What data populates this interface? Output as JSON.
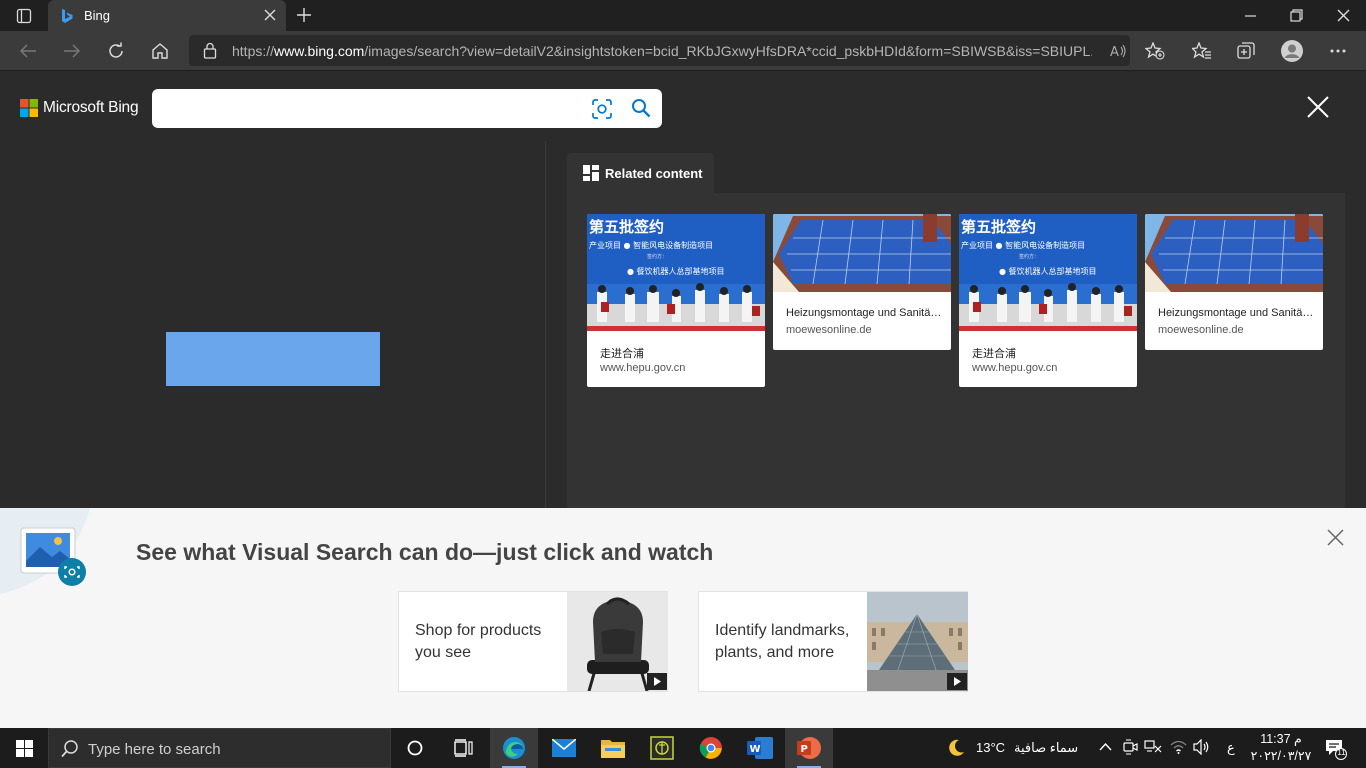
{
  "browser": {
    "tab_title": "Bing",
    "url_prefix": "https://",
    "url_domain": "www.bing.com",
    "url_rest": "/images/search?view=detailV2&insightstoken=bcid_RKbJGxwyHfsDRA*ccid_pskbHDId&form=SBIWSB&iss=SBIUPL..."
  },
  "bing": {
    "brand": "Microsoft Bing",
    "search_value": ""
  },
  "related": {
    "tab_label": "Related content",
    "cards": [
      {
        "title": "走进合浦",
        "site": "www.hepu.gov.cn",
        "image": "ceremony"
      },
      {
        "title": "Heizungsmontage und Sanitä…",
        "site": "moewesonline.de",
        "image": "solar-roof"
      },
      {
        "title": "走进合浦",
        "site": "www.hepu.gov.cn",
        "image": "ceremony"
      },
      {
        "title": "Heizungsmontage und Sanitä…",
        "site": "moewesonline.de",
        "image": "solar-roof"
      }
    ],
    "ceremony_banner_lines": [
      "第五批签约",
      "产业项目 ● 智能风电设备制造项目",
      "签约方：",
      "● 餐饮机器人总部基地项目"
    ]
  },
  "visual_search": {
    "headline": "See what Visual Search can do—just click and watch",
    "cards": [
      {
        "text": "Shop for products you see",
        "image": "backpack-on-chair"
      },
      {
        "text": "Identify landmarks, plants, and more",
        "image": "louvre-pyramid"
      }
    ]
  },
  "taskbar": {
    "search_placeholder": "Type here to search",
    "weather_icon": "moon-icon",
    "temperature": "13°C",
    "weather_text": "سماء صافية",
    "language": "ع",
    "time": "م 11:37",
    "date": "٢٠٢٢/٠٣/٢٧",
    "notification_count": "11"
  },
  "colors": {
    "bing_blue": "#0078d4",
    "placeholder_blue": "#6aa6ec"
  }
}
